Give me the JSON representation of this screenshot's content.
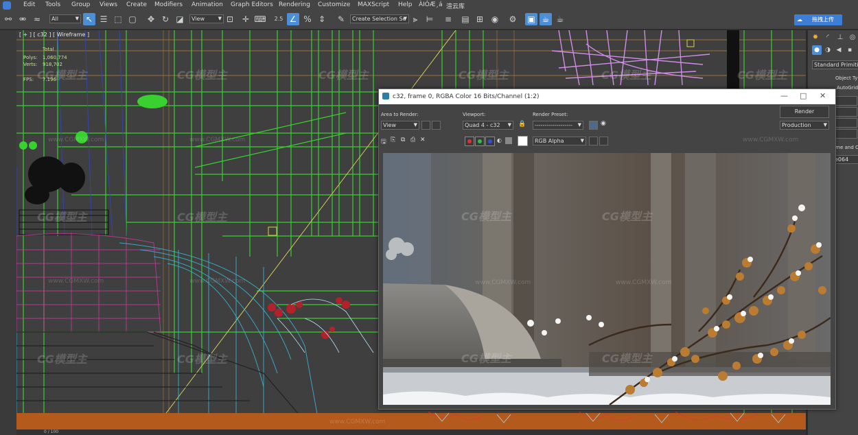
{
  "menu": {
    "items": [
      "Edit",
      "Tools",
      "Group",
      "Views",
      "Create",
      "Modifiers",
      "Animation",
      "Graph Editors",
      "Rendering",
      "Customize",
      "MAXScript",
      "Help",
      "ÀIÓÆ¸á",
      "渲云库"
    ]
  },
  "toolbar": {
    "filter_value": "All",
    "view_value": "View",
    "selection_set_placeholder": "Create Selection Se",
    "snap_label": "2.5",
    "cloud_button": "拖拽上传"
  },
  "viewport": {
    "label": "[ + ] [ c32 ] [ Wireframe ]",
    "stats": {
      "total_label": "Total",
      "polys_label": "Polys:",
      "polys_value": "1,060,774",
      "verts_label": "Verts:",
      "verts_value": "918,702",
      "fps_label": "FPS:",
      "fps_value": "7.196"
    }
  },
  "command_panel": {
    "dropdown": "Standard Primitives",
    "object_type": "Object Typ",
    "autogrid": "AutoGrid",
    "name_color": "ame and C",
    "name_value": "e064"
  },
  "render_window": {
    "title": "c32, frame 0, RGBA Color 16 Bits/Channel (1:2)",
    "area_label": "Area to Render:",
    "area_value": "View",
    "viewport_label": "Viewport:",
    "viewport_value": "Quad 4 - c32",
    "preset_label": "Render Preset:",
    "preset_value": "-------------------",
    "render_button": "Render",
    "production_value": "Production",
    "channel_value": "RGB Alpha"
  },
  "timeline": {
    "frame": "0 / 100"
  },
  "watermarks": {
    "logo_text": "CG模型主",
    "url_text": "www.CGMXW.com"
  },
  "colors": {
    "accent": "#4d8fd6",
    "viewport_bg": "#3f3f3f",
    "wire_green": "#39d12f",
    "wire_magenta": "#c83a9b",
    "wire_cyan": "#38b9d6"
  }
}
